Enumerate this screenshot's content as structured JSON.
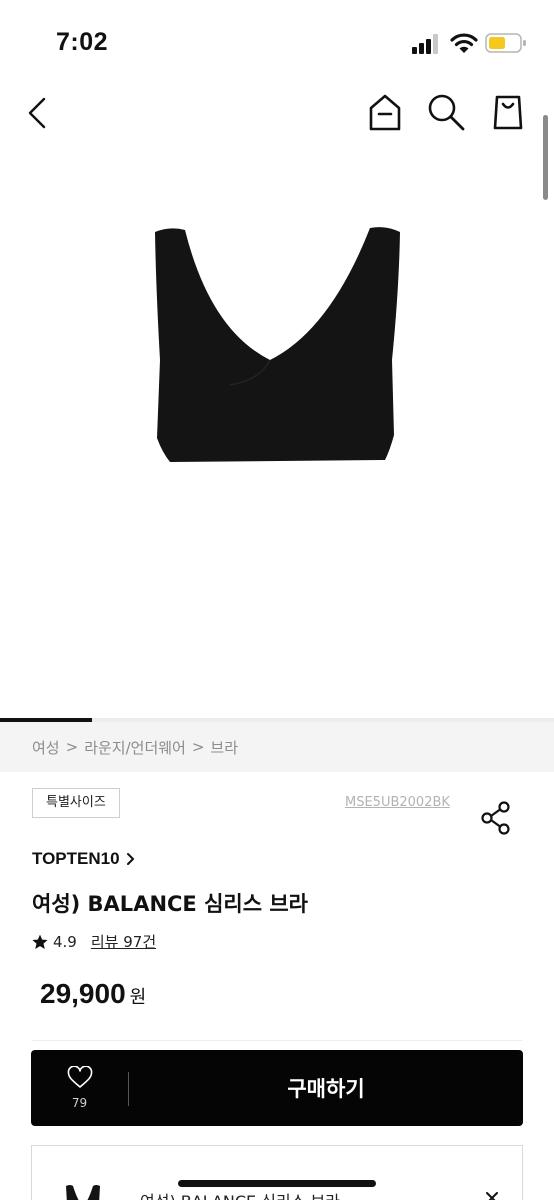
{
  "status_bar": {
    "time": "7:02"
  },
  "nav": {
    "back": "back-icon",
    "home": "home-icon",
    "search": "search-icon",
    "bag": "shopping-bag-icon"
  },
  "image_gallery": {
    "progress_fraction": 0.166
  },
  "breadcrumb": [
    "여성",
    "라운지/언더웨어",
    "브라"
  ],
  "breadcrumb_separator": ">",
  "product": {
    "badge": "특별사이즈",
    "code": "MSE5UB2002BK",
    "brand": "TOPTEN10",
    "title": "여성) BALANCE 심리스 브라",
    "rating": "4.9",
    "review_text": "리뷰 97건",
    "price": "29,900",
    "price_unit": "원"
  },
  "purchase_bar": {
    "wish_count": "79",
    "buy_label": "구매하기"
  },
  "option_card": {
    "title": "여성) BALANCE 심리스 브라"
  },
  "colors": {
    "primary": "#050505",
    "breadcrumb_bg": "#f4f4f4",
    "muted_text": "#8c8c8c",
    "battery": "#f4c81d"
  }
}
